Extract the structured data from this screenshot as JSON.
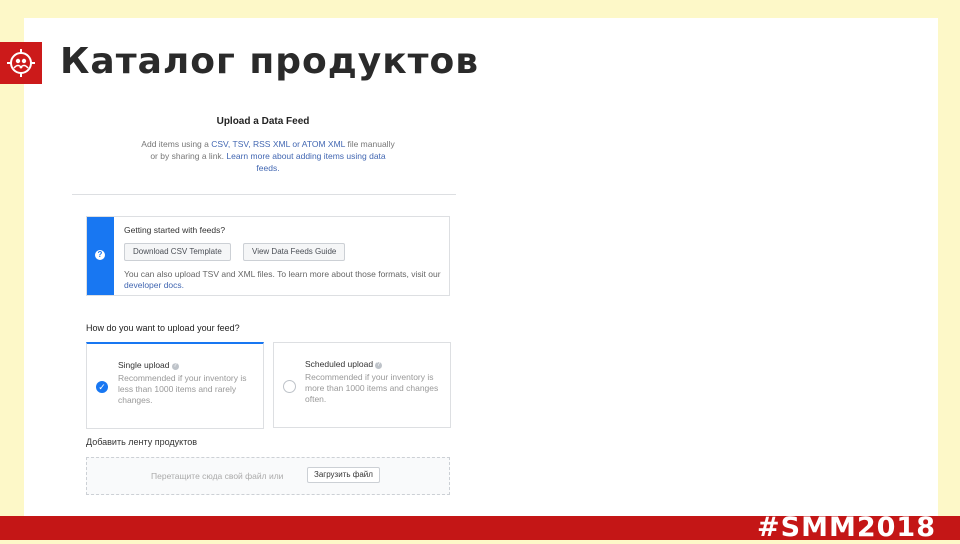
{
  "slide": {
    "title": "Каталог продуктов",
    "footer_hashtag": "#SMM2018"
  },
  "upload_dialog": {
    "title": "Upload a Data Feed",
    "desc_prefix": "Add items using a ",
    "desc_link_formats": "CSV, TSV, RSS XML or ATOM XML",
    "desc_middle": " file manually or by sharing a link. ",
    "desc_link_learn": "Learn more about adding items using data feeds."
  },
  "getting_started": {
    "heading": "Getting started with feeds?",
    "download_csv_button": "Download CSV Template",
    "guide_button": "View Data Feeds Guide",
    "note": "You can also upload TSV and XML files. To learn more about those formats, visit our ",
    "note_link": "developer docs."
  },
  "upload_method": {
    "question": "How do you want to upload your feed?",
    "options": [
      {
        "title": "Single upload",
        "desc": "Recommended if your inventory is less than 1000 items and rarely changes.",
        "selected": true
      },
      {
        "title": "Scheduled upload",
        "desc": "Recommended if your inventory is more than 1000 items and changes often.",
        "selected": false
      }
    ]
  },
  "add_feed": {
    "label": "Добавить ленту продуктов",
    "dropzone_text": "Перетащите сюда свой файл или",
    "upload_button": "Загрузить файл"
  },
  "colors": {
    "accent_red": "#c41616",
    "facebook_blue": "#1877f2",
    "background_yellow": "#fdf8c8"
  },
  "icons": [
    "community-logo-icon",
    "help-icon",
    "checkmark-icon",
    "radio-empty-icon",
    "info-icon"
  ]
}
